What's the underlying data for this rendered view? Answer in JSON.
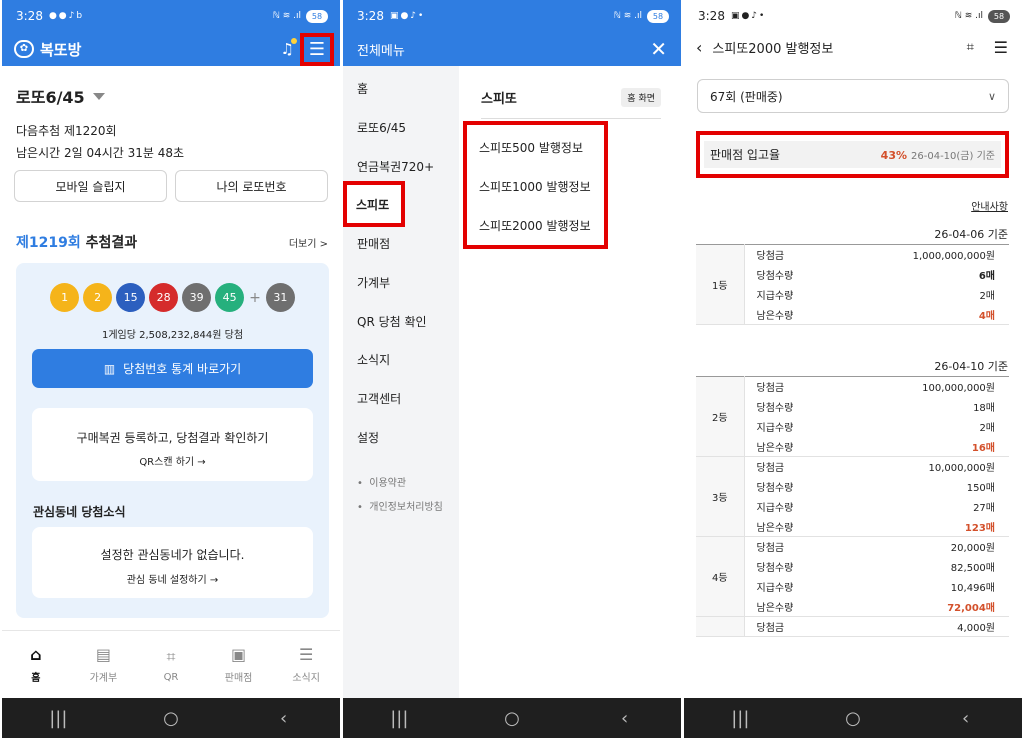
{
  "status": {
    "time": "3:28",
    "battery": "58"
  },
  "panel1": {
    "app_title": "복또방",
    "logo_glyph": "✿",
    "game_name": "로또6/45",
    "next_draw": "다음추첨 제1220회",
    "time_left": "남은시간 2일 04시간 31분 48초",
    "btn_mobile": "모바일 슬립지",
    "btn_my": "나의 로또번호",
    "result_round": "제1219회",
    "result_suffix": " 추첨결과",
    "more": "더보기 >",
    "balls": [
      {
        "n": "1",
        "color": "#f5b41a"
      },
      {
        "n": "2",
        "color": "#f5b41a"
      },
      {
        "n": "15",
        "color": "#2c5fbf"
      },
      {
        "n": "28",
        "color": "#d52b2b"
      },
      {
        "n": "39",
        "color": "#6f6f6f"
      },
      {
        "n": "45",
        "color": "#26b07d"
      }
    ],
    "bonus": {
      "n": "31",
      "color": "#6f6f6f"
    },
    "plus": "+",
    "prize_line": "1게임당 2,508,232,844원 당첨",
    "stats_btn": "당첨번호 통계 바로가기",
    "stats_icon": "▥",
    "register_title": "구매복권 등록하고, 당첨결과 확인하기",
    "register_sub": "QR스캔 하기 →",
    "nb_title": "관심동네 당첨소식",
    "nb_empty": "설정한 관심동네가 없습니다.",
    "nb_sub": "관심 동네 설정하기 →",
    "tabs": [
      {
        "label": "홈",
        "icon": "⌂"
      },
      {
        "label": "가계부",
        "icon": "▤"
      },
      {
        "label": "QR",
        "icon": "⌗"
      },
      {
        "label": "판매점",
        "icon": "▣"
      },
      {
        "label": "소식지",
        "icon": "☰"
      }
    ]
  },
  "panel2": {
    "title": "전체메뉴",
    "close": "✕",
    "menu": [
      "홈",
      "로또6/45",
      "연금복권720+",
      "스피또",
      "판매점",
      "가계부",
      "QR 당첨 확인",
      "소식지",
      "고객센터",
      "설정"
    ],
    "small": [
      "이용약관",
      "개인정보처리방침"
    ],
    "section": "스피또",
    "home_chip": "홈 화면",
    "sub": [
      "스피또500 발행정보",
      "스피또1000 발행정보",
      "스피또2000 발행정보"
    ]
  },
  "panel3": {
    "title": "스피또2000 발행정보",
    "round": "67회 (판매중)",
    "stock_label": "판매점 입고율",
    "stock_pct": "43%",
    "stock_date": "26-04-10(금) 기준",
    "notice": "안내사항",
    "date1": "26-04-06 기준",
    "date2": "26-04-10 기준",
    "keys": [
      "당첨금",
      "당첨수량",
      "지급수량",
      "남은수량"
    ],
    "prizes": [
      {
        "rank": "1등",
        "values": [
          "1,000,000,000원",
          "6매",
          "2매",
          "4매"
        ]
      },
      {
        "rank": "2등",
        "values": [
          "100,000,000원",
          "18매",
          "2매",
          "16매"
        ]
      },
      {
        "rank": "3등",
        "values": [
          "10,000,000원",
          "150매",
          "27매",
          "123매"
        ]
      },
      {
        "rank": "4등",
        "values": [
          "20,000원",
          "82,500매",
          "10,496매",
          "72,004매"
        ]
      }
    ],
    "cut_key": "당첨금",
    "cut_value": "4,000원"
  }
}
